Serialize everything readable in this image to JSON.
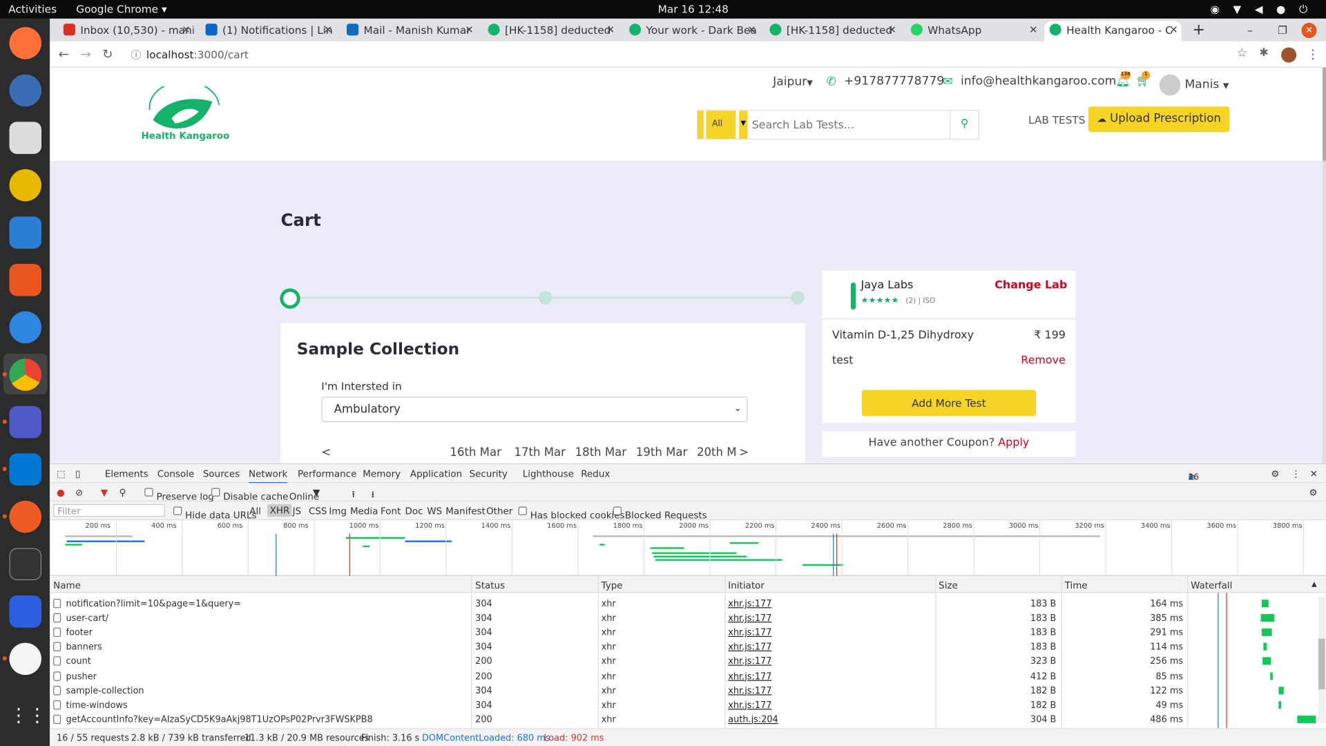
{
  "system": {
    "activities": "Activities",
    "app_name": "Google Chrome ▾",
    "clock": "Mar 16  12:48"
  },
  "tabs": [
    {
      "label": "Inbox (10,530) - mani",
      "color": "#d93025"
    },
    {
      "label": "(1) Notifications | Lin",
      "color": "#0a66c2"
    },
    {
      "label": "Mail - Manish Kumar",
      "color": "#0f6cbd"
    },
    {
      "label": "[HK-1158] deducted",
      "color": "#17b26a"
    },
    {
      "label": "Your work - Dark Bea",
      "color": "#17b26a"
    },
    {
      "label": "[HK-1158] deducted",
      "color": "#17b26a"
    },
    {
      "label": "WhatsApp",
      "color": "#25d366"
    },
    {
      "label": "Health Kangaroo - C",
      "color": "#17b26a"
    }
  ],
  "address": {
    "host": "localhost",
    "path": ":3000/cart"
  },
  "site": {
    "logo_text": "Health Kangaroo",
    "city": "Jaipur",
    "phone": "+917877778779",
    "email": "info@healthkangaroo.com",
    "notif_count": "138",
    "cart_count": "1",
    "user": "Manis",
    "search_category": "All",
    "search_placeholder": "Search Lab Tests...",
    "lab_tests_link": "LAB TESTS",
    "upload_label": "Upload Prescription"
  },
  "cart": {
    "title": "Cart",
    "sample_heading": "Sample Collection",
    "interest_label": "I'm Intersted in",
    "interest_value": "Ambulatory",
    "prev": "<",
    "next": ">",
    "dates": [
      "16th Mar",
      "17th Mar",
      "18th Mar",
      "19th Mar",
      "20th M"
    ],
    "lab_name": "Jaya Labs",
    "lab_rating": "★★★★★",
    "lab_meta": "(2) | ISO",
    "change_lab": "Change Lab",
    "test_name": "Vitamin D-1,25 Dihydroxy",
    "test_price": "₹ 199",
    "test2": "test",
    "remove": "Remove",
    "add_more": "Add More Test",
    "coupon_q": "Have another Coupon?",
    "apply": "Apply"
  },
  "devtools": {
    "tabs": [
      "Elements",
      "Console",
      "Sources",
      "Network",
      "Performance",
      "Memory",
      "Application",
      "Security",
      "Lighthouse",
      "Redux"
    ],
    "errors": "1",
    "warnings": "1",
    "messages": "26",
    "preserve_log": "Preserve log",
    "disable_cache": "Disable cache",
    "throttle": "Online",
    "filter_placeholder": "Filter",
    "hide_data_urls": "Hide data URLs",
    "types": [
      "All",
      "XHR",
      "JS",
      "CSS",
      "Img",
      "Media",
      "Font",
      "Doc",
      "WS",
      "Manifest",
      "Other"
    ],
    "blocked_cookies": "Has blocked cookies",
    "blocked_requests": "Blocked Requests",
    "ticks": [
      "200 ms",
      "400 ms",
      "600 ms",
      "800 ms",
      "1000 ms",
      "1200 ms",
      "1400 ms",
      "1600 ms",
      "1800 ms",
      "2000 ms",
      "2200 ms",
      "2400 ms",
      "2600 ms",
      "2800 ms",
      "3000 ms",
      "3200 ms",
      "3400 ms",
      "3600 ms",
      "3800 ms"
    ],
    "columns": [
      "Name",
      "Status",
      "Type",
      "Initiator",
      "Size",
      "Time",
      "Waterfall"
    ],
    "requests": [
      {
        "name": "notification?limit=10&page=1&query=",
        "status": "304",
        "type": "xhr",
        "initiator": "xhr.js:177",
        "size": "183 B",
        "time": "164 ms"
      },
      {
        "name": "user-cart/",
        "status": "304",
        "type": "xhr",
        "initiator": "xhr.js:177",
        "size": "183 B",
        "time": "385 ms"
      },
      {
        "name": "footer",
        "status": "304",
        "type": "xhr",
        "initiator": "xhr.js:177",
        "size": "183 B",
        "time": "291 ms"
      },
      {
        "name": "banners",
        "status": "304",
        "type": "xhr",
        "initiator": "xhr.js:177",
        "size": "183 B",
        "time": "114 ms"
      },
      {
        "name": "count",
        "status": "200",
        "type": "xhr",
        "initiator": "xhr.js:177",
        "size": "323 B",
        "time": "256 ms"
      },
      {
        "name": "pusher",
        "status": "200",
        "type": "xhr",
        "initiator": "xhr.js:177",
        "size": "412 B",
        "time": "85 ms"
      },
      {
        "name": "sample-collection",
        "status": "304",
        "type": "xhr",
        "initiator": "xhr.js:177",
        "size": "182 B",
        "time": "122 ms"
      },
      {
        "name": "time-windows",
        "status": "304",
        "type": "xhr",
        "initiator": "xhr.js:177",
        "size": "182 B",
        "time": "49 ms"
      },
      {
        "name": "getAccountInfo?key=AIzaSyCD5K9aAkj98T1UzOPsP02Prvr3FWSKPB8",
        "status": "200",
        "type": "xhr",
        "initiator": "auth.js:204",
        "size": "304 B",
        "time": "486 ms"
      }
    ],
    "status": {
      "requests": "16 / 55 requests",
      "transferred": "2.8 kB / 739 kB transferred",
      "resources": "11.3 kB / 20.9 MB resources",
      "finish": "Finish: 3.16 s",
      "dcl": "DOMContentLoaded: 680 ms",
      "load": "Load: 902 ms"
    }
  },
  "colors": {
    "brand": "#17b26a",
    "accent": "#f5d327",
    "danger": "#d0021b",
    "page_bg": "#ececf8"
  }
}
